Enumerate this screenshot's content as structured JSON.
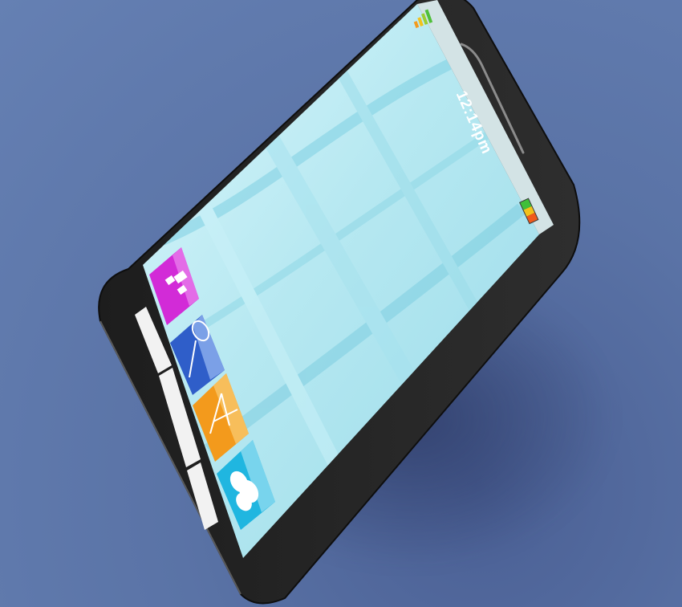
{
  "status_bar": {
    "time": "12:14pm",
    "signal_icon": "signal-bars-icon",
    "battery_icon": "battery-icon"
  },
  "home_screen": {
    "app_tiles": [
      {
        "icon": "puzzle-icon",
        "color": "#d22bd7"
      },
      {
        "icon": "magnifier-icon",
        "color": "#2f5ec9"
      },
      {
        "icon": "compass-icon",
        "color": "#f39a1c"
      },
      {
        "icon": "cloud-icon",
        "color": "#20b6e0"
      }
    ]
  },
  "colors": {
    "background": "#5a73a6",
    "device_frame": "#2b2b2b",
    "screen": "#bfeaf2"
  }
}
